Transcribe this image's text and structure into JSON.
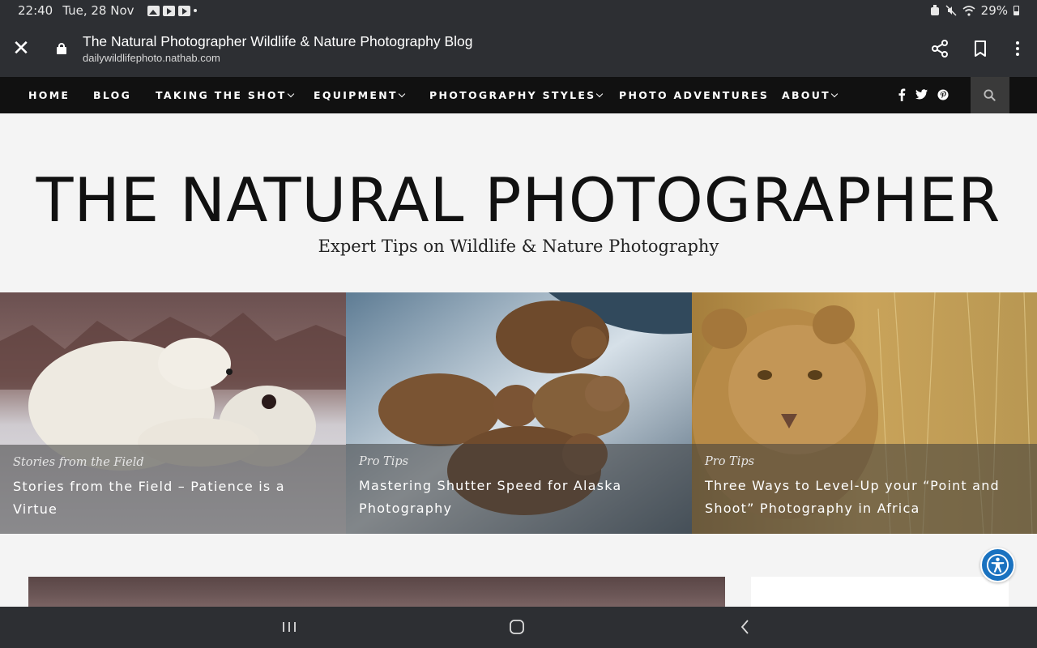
{
  "status_bar": {
    "time": "22:40",
    "date": "Tue, 28 Nov",
    "battery": "29%"
  },
  "browser": {
    "page_title": "The Natural Photographer Wildlife & Nature Photography Blog",
    "url": "dailywildlifephoto.nathab.com"
  },
  "nav": {
    "items": [
      {
        "label": "HOME",
        "has_dropdown": false
      },
      {
        "label": "BLOG",
        "has_dropdown": false
      },
      {
        "label": "TAKING THE SHOT",
        "has_dropdown": true
      },
      {
        "label": "EQUIPMENT",
        "has_dropdown": true
      },
      {
        "label": "PHOTOGRAPHY STYLES",
        "has_dropdown": true
      },
      {
        "label": "PHOTO ADVENTURES",
        "has_dropdown": false
      },
      {
        "label": "ABOUT",
        "has_dropdown": true
      }
    ],
    "social": [
      {
        "name": "facebook-icon",
        "glyph": "f"
      },
      {
        "name": "twitter-icon",
        "glyph": "t"
      },
      {
        "name": "pinterest-icon",
        "glyph": "p"
      }
    ]
  },
  "header": {
    "site_title": "THE NATURAL PHOTOGRAPHER",
    "tagline": "Expert Tips on Wildlife & Nature Photography"
  },
  "featured": [
    {
      "category": "Stories from the Field",
      "title": "Stories from the Field – Patience is a Virtue",
      "image": "polar-bears"
    },
    {
      "category": "Pro Tips",
      "title": "Mastering Shutter Speed for Alaska Photography",
      "image": "brown-bears"
    },
    {
      "category": "Pro Tips",
      "title": "Three Ways to Level-Up your “Point and Shoot” Photography in Africa",
      "image": "lion"
    }
  ],
  "colors": {
    "nav_bg": "#111111",
    "chrome_bg": "#2d2f33",
    "accessibility_blue": "#1a72c0"
  }
}
